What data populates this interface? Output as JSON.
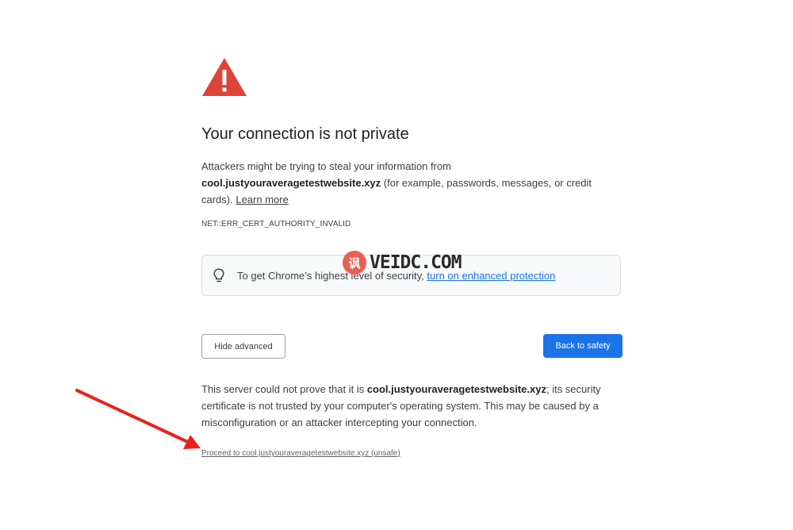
{
  "icons": {
    "warning": "warning-triangle-icon",
    "bulb": "lightbulb-icon",
    "arrow": "red-arrow"
  },
  "colors": {
    "warning_red": "#db4437",
    "primary_blue": "#1a73e8",
    "arrow_red": "#e8231b"
  },
  "heading": "Your connection is not private",
  "explanation": {
    "before": "Attackers might be trying to steal your information from ",
    "domain": "cool.justyouraveragetestwebsite.xyz",
    "after": " (for example, passwords, messages, or credit cards). ",
    "learn_more": "Learn more"
  },
  "error_code": "NET::ERR_CERT_AUTHORITY_INVALID",
  "protection": {
    "text": "To get Chrome’s highest level of security, ",
    "link": "turn on enhanced protection"
  },
  "watermark": {
    "logo_text": "讽",
    "text": "VEIDC.COM"
  },
  "buttons": {
    "hide_advanced": "Hide advanced",
    "back_to_safety": "Back to safety"
  },
  "details": {
    "before": "This server could not prove that it is ",
    "domain": "cool.justyouraveragetestwebsite.xyz",
    "after": "; its security certificate is not trusted by your computer's operating system. This may be caused by a misconfiguration or an attacker intercepting your connection."
  },
  "proceed_link": "Proceed to cool.justyouraveragetestwebsite.xyz (unsafe)"
}
